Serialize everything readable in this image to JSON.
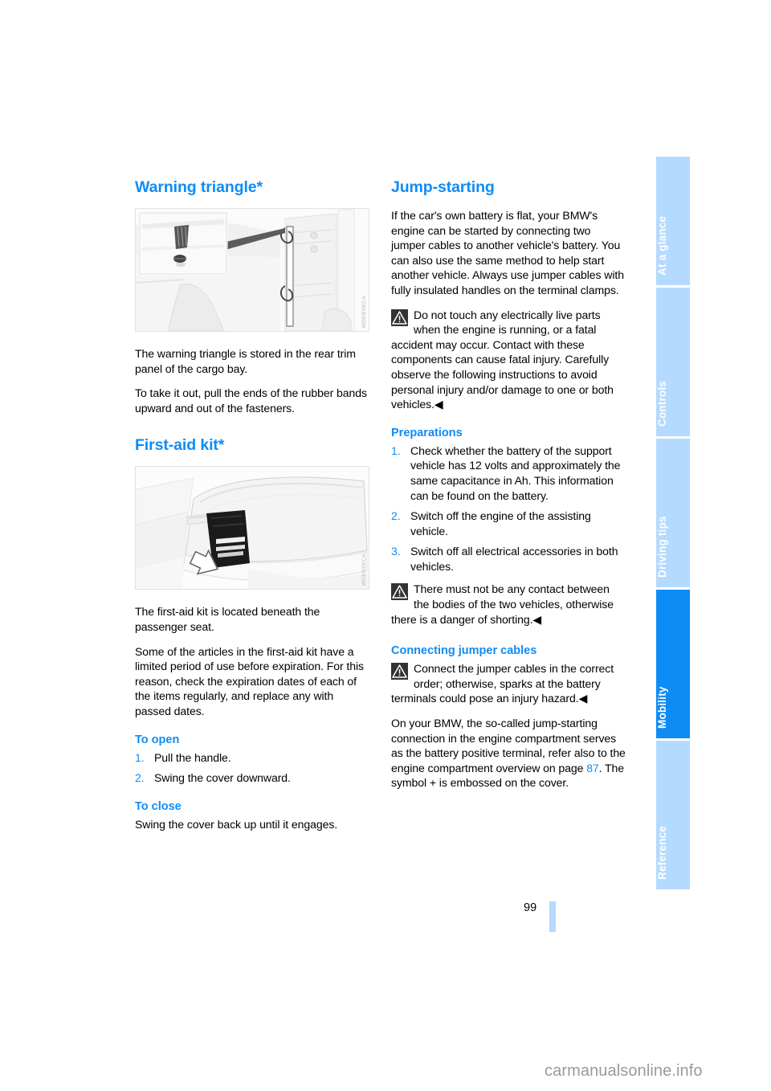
{
  "document": {
    "page_number": "99",
    "watermark": "carmanualsonline.info"
  },
  "tabs": [
    {
      "label": "At a glance",
      "active": false
    },
    {
      "label": "Controls",
      "active": false
    },
    {
      "label": "Driving tips",
      "active": false
    },
    {
      "label": "Mobility",
      "active": true
    },
    {
      "label": "Reference",
      "active": false
    }
  ],
  "left_column": {
    "heading_warning_triangle": "Warning triangle*",
    "figure1_code": "WDEBSKCA",
    "para1": "The warning triangle is stored in the rear trim panel of the cargo bay.",
    "para2": "To take it out, pull the ends of the rubber bands upward and out of the fasteners.",
    "heading_first_aid": "First-aid kit*",
    "figure2_code": "WDEBSKCA",
    "para3": "The first-aid kit is located beneath the passenger seat.",
    "para4": "Some of the articles in the first-aid kit have a limited period of use before expiration. For this reason, check the expiration dates of each of the items regularly, and replace any with passed dates.",
    "heading_to_open": "To open",
    "open_steps": [
      {
        "num": "1.",
        "text": "Pull the handle."
      },
      {
        "num": "2.",
        "text": "Swing the cover downward."
      }
    ],
    "heading_to_close": "To close",
    "para5": "Swing the cover back up until it engages."
  },
  "right_column": {
    "heading_jump_starting": "Jump-starting",
    "para1": "If the car's own battery is flat, your BMW's engine can be started by connecting two jumper cables to another vehicle's battery. You can also use the same method to help start another vehicle. Always use jumper cables with fully insulated handles on the terminal clamps.",
    "warning1": "Do not touch any electrically live parts when the engine is running, or a fatal accident may occur. Contact with these components can cause fatal injury. Carefully observe the following instructions to avoid personal injury and/or damage to one or both vehicles.◀",
    "heading_preparations": "Preparations",
    "prep_steps": [
      {
        "num": "1.",
        "text": "Check whether the battery of the support vehicle has 12 volts and approximately the same capacitance in Ah. This information can be found on the battery."
      },
      {
        "num": "2.",
        "text": "Switch off the engine of the assisting vehicle."
      },
      {
        "num": "3.",
        "text": "Switch off all electrical accessories in both vehicles."
      }
    ],
    "warning2": "There must not be any contact between the bodies of the two vehicles, otherwise there is a danger of shorting.◀",
    "heading_connecting": "Connecting jumper cables",
    "warning3": "Connect the jumper cables in the correct order; otherwise, sparks at the battery terminals could pose an injury hazard.◀",
    "para2_part1": "On your BMW, the so-called jump-starting connection in the engine compartment serves as the battery positive terminal, refer also to the engine compartment overview on page ",
    "para2_pageref": "87",
    "para2_part2": ". The symbol + is embossed on the cover."
  },
  "colors": {
    "accent_blue": "#0e8cf5",
    "tab_inactive": "#b5daff",
    "text": "#000000"
  }
}
